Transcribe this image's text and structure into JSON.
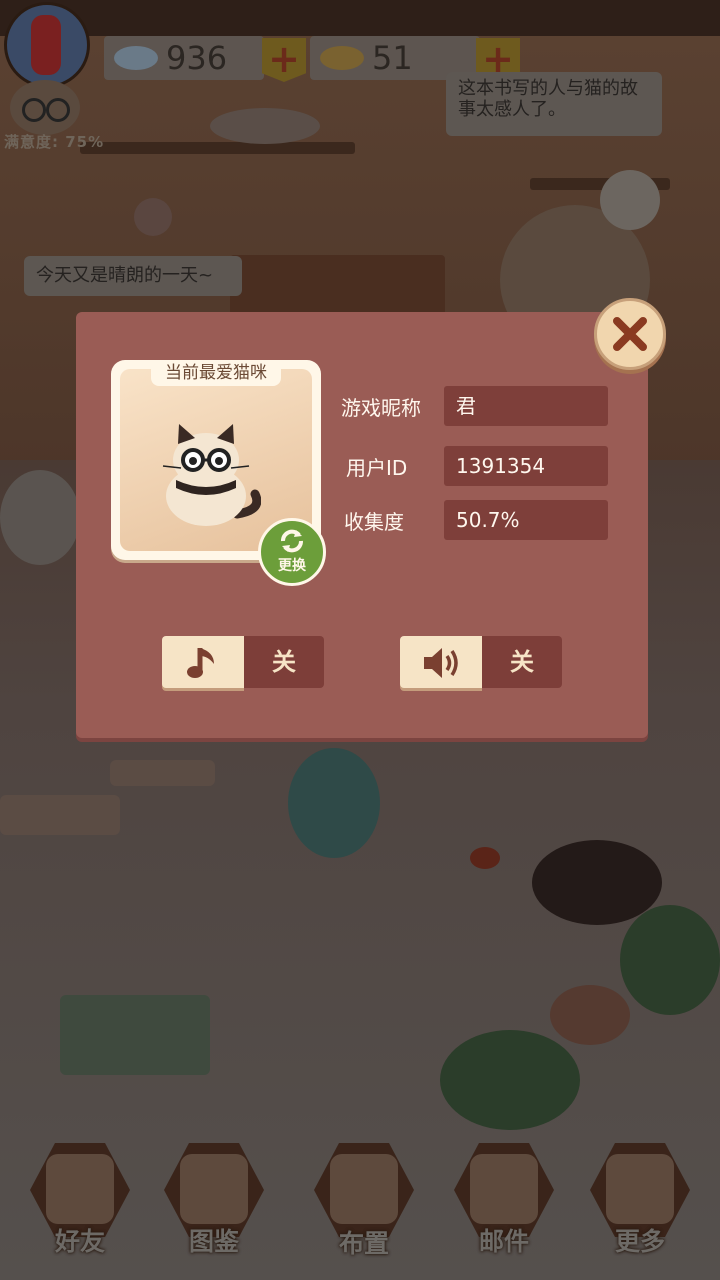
{
  "hud": {
    "fish_count": "936",
    "gold_fish_count": "51",
    "satisfaction": "满意度: 75%"
  },
  "speech": {
    "granny": "这本书写的人与猫的故事太感人了。",
    "player": "今天又是晴朗的一天~"
  },
  "profile_dialog": {
    "card_title": "当前最爱猫咪",
    "swap_label": "更换",
    "fields": [
      {
        "label": "游戏昵称",
        "value": "君"
      },
      {
        "label": "用户ID",
        "value": "1391354"
      },
      {
        "label": "收集度",
        "value": "50.7%"
      }
    ],
    "music_toggle": {
      "icon": "music-note-icon",
      "state": "关"
    },
    "sound_toggle": {
      "icon": "speaker-icon",
      "state": "关"
    },
    "close_icon": "close-icon"
  },
  "nav": [
    {
      "label": "好友",
      "icon": "friends-icon"
    },
    {
      "label": "图鉴",
      "icon": "catalog-icon"
    },
    {
      "label": "布置",
      "icon": "decorate-icon"
    },
    {
      "label": "邮件",
      "icon": "mail-icon"
    },
    {
      "label": "更多",
      "icon": "more-icon"
    }
  ],
  "colors": {
    "dialog_bg": "#9a5c55",
    "field_bg": "#7e3f3a",
    "toggle_light": "#f6e4c6",
    "swap_green": "#6c9e3a"
  }
}
